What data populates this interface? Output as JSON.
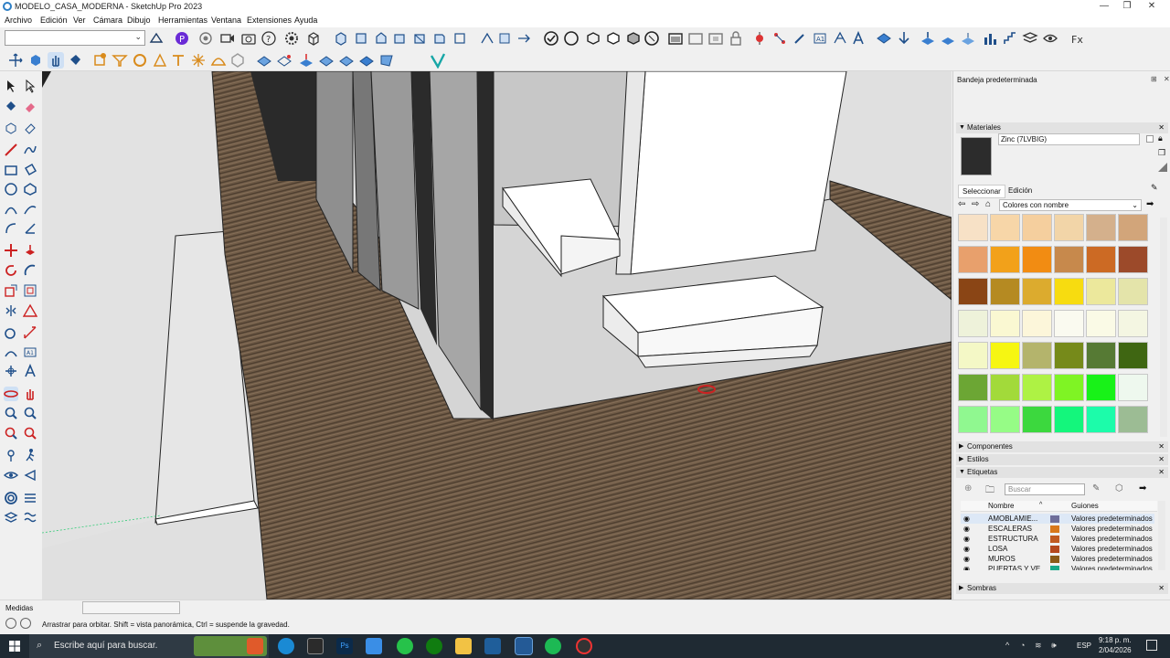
{
  "window": {
    "title": "MODELO_CASA_MODERNA - SketchUp Pro 2023"
  },
  "menu": [
    "Archivo",
    "Edición",
    "Ver",
    "Cámara",
    "Dibujo",
    "Herramientas",
    "Ventana",
    "Extensiones",
    "Ayuda"
  ],
  "tray": {
    "title": "Bandeja predeterminada",
    "materials": {
      "header": "Materiales",
      "current_name": "Zinc (7LVBIG)",
      "tabs": [
        "Seleccionar",
        "Edición"
      ],
      "library": "Colores con nombre",
      "swatches": [
        "#f7e1c6",
        "#f7d6a8",
        "#f5cf9e",
        "#f2d5a8",
        "#d4b08c",
        "#d2a57a",
        "#e8a06c",
        "#f2a11a",
        "#f28c12",
        "#c7894c",
        "#cc6a24",
        "#9c4a2a",
        "#8a4515",
        "#b58a22",
        "#dcab2e",
        "#f7dc10",
        "#ece89c",
        "#e4e4aa",
        "#eef2da",
        "#faf8d2",
        "#fcf6da",
        "#fafaf0",
        "#fafae6",
        "#f4f6e2",
        "#f4f8c6",
        "#f6f612",
        "#b4b46c",
        "#768a1a",
        "#567a34",
        "#3f6612",
        "#6ca634",
        "#a2da3a",
        "#aef244",
        "#7ff424",
        "#18f218",
        "#eef8ee",
        "#90f890",
        "#96fc86",
        "#3cd83e",
        "#14f67c",
        "#1cfcaa",
        "#9cbc94"
      ]
    },
    "components_label": "Componentes",
    "styles_label": "Estilos",
    "tags": {
      "header": "Etiquetas",
      "search_placeholder": "Buscar",
      "col_name": "Nombre",
      "col_dash": "Guiones",
      "rows": [
        {
          "name": "AMOBLAMIE...",
          "color": "#6e6e9a",
          "dash": "Valores predeterminados"
        },
        {
          "name": "ESCALERAS",
          "color": "#d8781c",
          "dash": "Valores predeterminados"
        },
        {
          "name": "ESTRUCTURA",
          "color": "#c05a22",
          "dash": "Valores predeterminados"
        },
        {
          "name": "LOSA",
          "color": "#b4481e",
          "dash": "Valores predeterminados"
        },
        {
          "name": "MUROS",
          "color": "#8a5a18",
          "dash": "Valores predeterminados"
        },
        {
          "name": "PUERTAS Y VE...",
          "color": "#18a888",
          "dash": "Valores predeterminados"
        }
      ]
    },
    "shadows_label": "Sombras"
  },
  "status": {
    "measure_label": "Medidas",
    "hint": "Arrastrar para orbitar. Shift = vista panorámica, Ctrl = suspende la gravedad."
  },
  "taskbar": {
    "search_placeholder": "Escribe aquí para buscar.",
    "lang": "ESP",
    "time": "9:18 p. m.",
    "date": "2/04/2026"
  }
}
